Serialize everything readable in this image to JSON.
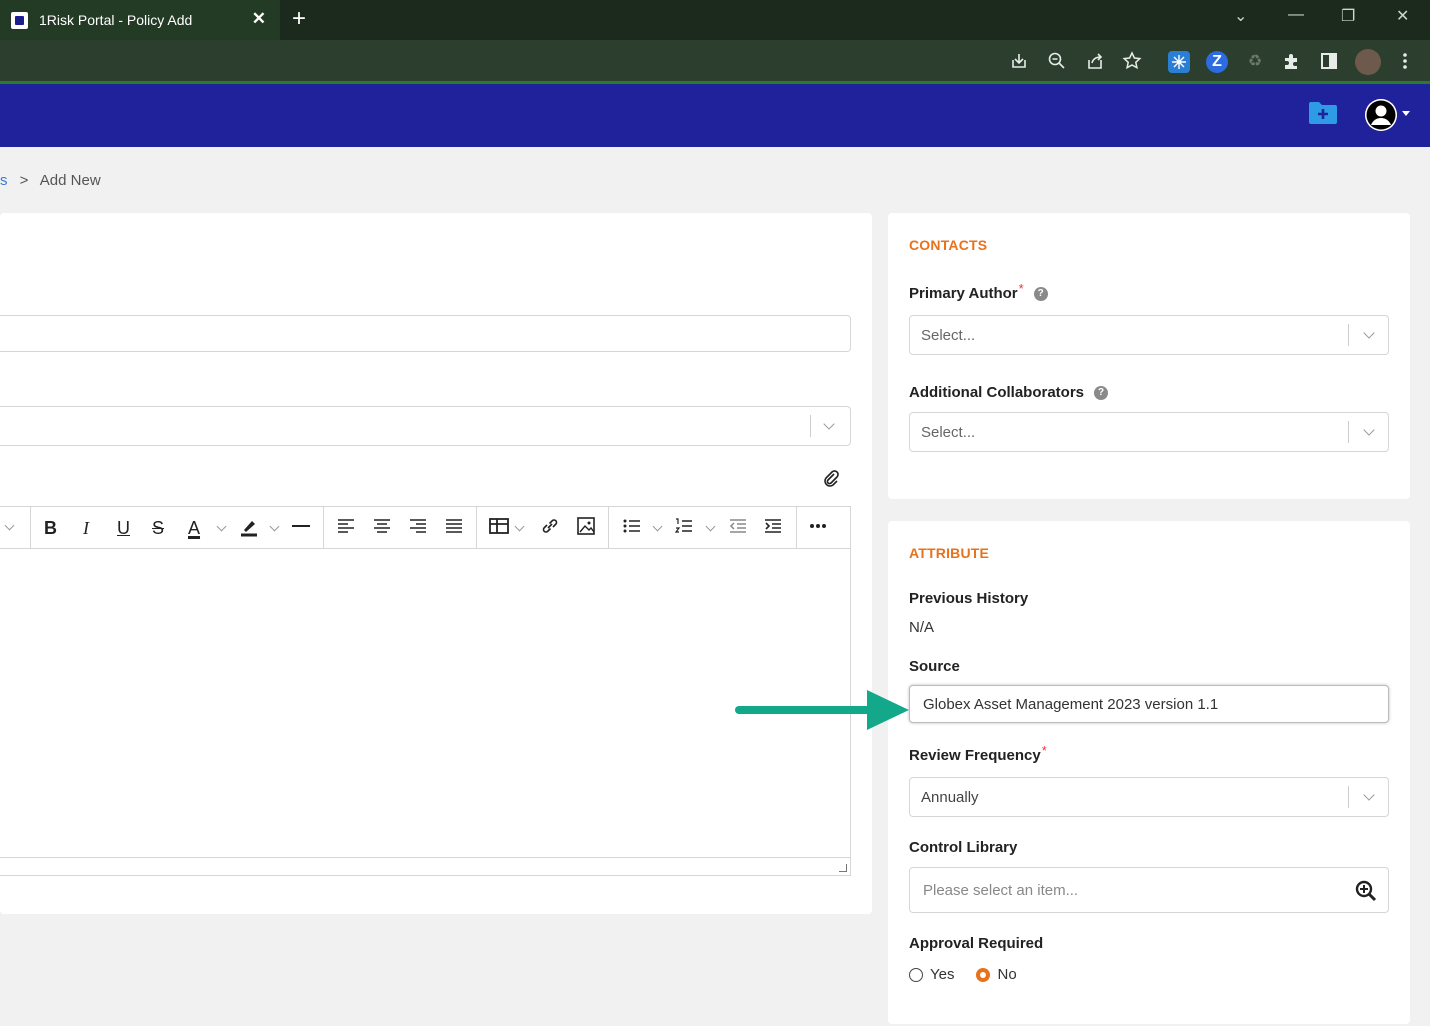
{
  "browser": {
    "tab_title": "1Risk Portal - Policy Add",
    "tab_close": "✕",
    "new_tab": "+",
    "window_controls": [
      "⌄",
      "—",
      "❐",
      "✕"
    ]
  },
  "colors": {
    "app_header": "#1f229a",
    "accent_orange": "#e8721c",
    "arrow_teal": "#13a88a",
    "link_blue": "#3a7bd5"
  },
  "breadcrumb": {
    "prev": "s",
    "separator": ">",
    "current": "Add New"
  },
  "editor": {
    "toolbar": {
      "bold": "B",
      "italic": "I",
      "underline": "U",
      "strike": "S",
      "font_color": "A"
    }
  },
  "contacts": {
    "title": "CONTACTS",
    "primary_author_label": "Primary Author",
    "required_mark": "*",
    "help": "?",
    "primary_author_value": "Select...",
    "collaborators_label": "Additional Collaborators",
    "collaborators_value": "Select..."
  },
  "attribute": {
    "title": "ATTRIBUTE",
    "previous_history_label": "Previous History",
    "previous_history_value": "N/A",
    "source_label": "Source",
    "source_value": "Globex Asset Management 2023 version 1.1",
    "review_frequency_label": "Review Frequency",
    "review_frequency_value": "Annually",
    "control_library_label": "Control Library",
    "control_library_placeholder": "Please select an item...",
    "approval_label": "Approval Required",
    "approval_options": [
      "Yes",
      "No"
    ],
    "approval_selected": "No"
  },
  "icons": [
    "download-icon",
    "zoom-icon",
    "share-icon",
    "star-icon",
    "extension-icon",
    "folder-add-icon",
    "user-avatar-icon",
    "paperclip-icon",
    "search-plus-icon",
    "arrow-annotation"
  ]
}
